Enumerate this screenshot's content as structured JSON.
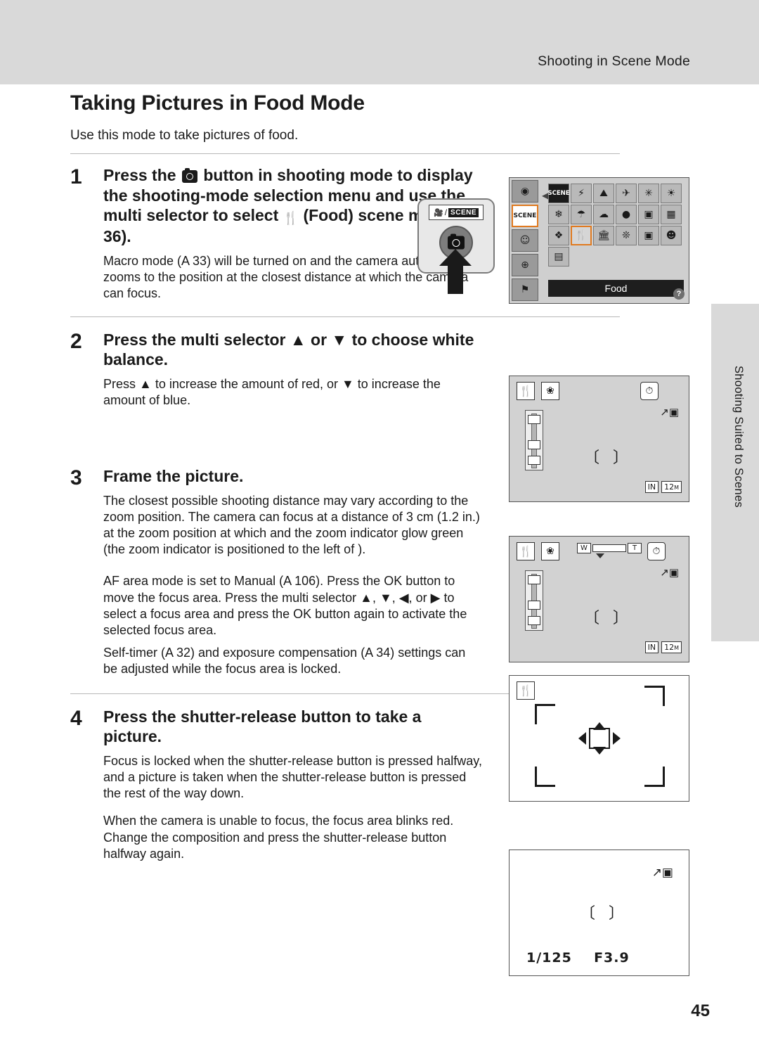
{
  "header": {
    "running_head": "Shooting in Scene Mode",
    "side_tab_label": "Shooting Suited to Scenes"
  },
  "title": "Taking Pictures in Food Mode",
  "intro": "Use this mode to take pictures of food.",
  "page_number": "45",
  "steps": [
    {
      "num": "1",
      "heading_parts": {
        "a": "Press the",
        "b": "button in shooting mode to display the shooting-mode selection menu and use the multi selector to select",
        "c": "(Food) scene mode (",
        "d": "36)."
      },
      "paragraphs": [
        "Macro mode (A 33) will be turned on and the camera automatically zooms to the position at the closest distance at which the camera can focus."
      ]
    },
    {
      "num": "2",
      "heading": "Press the multi selector ▲ or ▼ to choose white balance.",
      "paragraphs": [
        "Press ▲ to increase the amount of red, or ▼ to increase the amount of blue."
      ]
    },
    {
      "num": "3",
      "heading": "Frame the picture.",
      "paragraphs": [
        "The closest possible shooting distance may vary according to the zoom position. The camera can focus at a distance of 3 cm (1.2 in.) at the zoom position at which   and the zoom indicator glow green (the zoom indicator is positioned to the left of   ).",
        "AF area mode is set to Manual (A 106). Press the OK button to move the focus area. Press the multi selector ▲, ▼, ◀, or ▶ to select a focus area and press the OK button again to activate the selected focus area.",
        "Self-timer (A 32) and exposure compensation (A 34) settings can be adjusted while the focus area is locked."
      ],
      "inline": {
        "af_area_mode": "AF area mode",
        "is_set_to": "is set to",
        "manual": "Manual",
        "ref_106": "106",
        "press_the": "). Press the"
      }
    },
    {
      "num": "4",
      "heading": "Press the shutter-release button to take a picture.",
      "paragraphs": [
        "Focus is locked when the shutter-release button is pressed halfway, and a picture is taken when the shutter-release button is pressed the rest of the way down.",
        "When the camera is unable to focus, the focus area blinks red. Change the composition and press the shutter-release button halfway again."
      ]
    }
  ],
  "figures": {
    "mode_button": {
      "mode_label_left": "Ἲ5",
      "mode_label_right": "SCENE"
    },
    "scene_menu": {
      "selected_label": "Food",
      "help_glyph": "?",
      "left_icons": [
        "◉",
        "SCENE",
        "☺",
        "⊕",
        "⚑"
      ],
      "grid_icons": [
        "SCENE",
        "⚡",
        "Ἵ4",
        "Ἵ6",
        "✳",
        "❄",
        "ἰ5",
        "Ἵ9",
        "ἺC",
        "὏7",
        "⚘",
        "ἷ4",
        "ἽB",
        "⚙",
        "◱",
        "὆4",
        "❐"
      ]
    },
    "screen_white_balance": {
      "food_icon": "food-icon",
      "macro_icon": "macro-flower-icon",
      "timer_icon": "self-timer-icon",
      "image_size_label": "12",
      "image_mode_label": "IN"
    },
    "screen_frame": {
      "zoom_wide_label": "W",
      "zoom_tele_label": "T",
      "image_size_label": "12",
      "image_mode_label": "IN"
    },
    "screen_shutter": {
      "shutter_speed": "1/125",
      "aperture": "F3.9"
    }
  }
}
